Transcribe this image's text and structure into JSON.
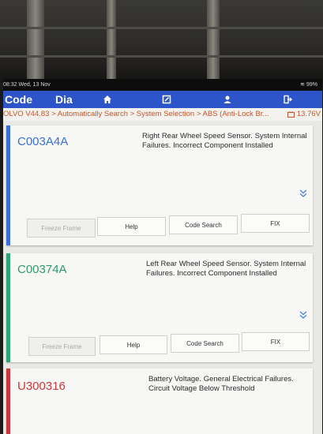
{
  "status_bar": {
    "time_date": "08:32  Wed, 13 Nov",
    "battery": "99%"
  },
  "app_bar": {
    "title_left": "Code",
    "title_right": "Dia",
    "tabs": [
      {
        "icon": "home-icon"
      },
      {
        "icon": "report-icon"
      },
      {
        "icon": "user-icon"
      },
      {
        "icon": "exit-icon"
      }
    ]
  },
  "breadcrumb": {
    "path": "OLVO V44.83 > Automatically Search > System Selection > ABS (Anti-Lock Br...",
    "voltage": "13.76V"
  },
  "colors": {
    "accent_blue": "#2d55c9",
    "stripe_1": "#3a6fd6",
    "stripe_2": "#2fa37a",
    "stripe_3": "#c8383b",
    "breadcrumb_text": "#c4552a"
  },
  "dtc_list": [
    {
      "code": "C003A4A",
      "description": "Right Rear Wheel Speed Sensor. System Internal Failures. Incorrect Component Installed",
      "buttons": {
        "freeze_frame": "Freeze Frame",
        "help": "Help",
        "code_search": "Code Search",
        "fix": "FIX"
      }
    },
    {
      "code": "C00374A",
      "description": "Left Rear Wheel Speed Sensor. System Internal Failures. Incorrect Component Installed",
      "buttons": {
        "freeze_frame": "Freeze Frame",
        "help": "Help",
        "code_search": "Code Search",
        "fix": "FIX"
      }
    },
    {
      "code": "U300316",
      "description": "Battery Voltage. General Electrical Failures. Circuit Voltage Below Threshold"
    }
  ]
}
